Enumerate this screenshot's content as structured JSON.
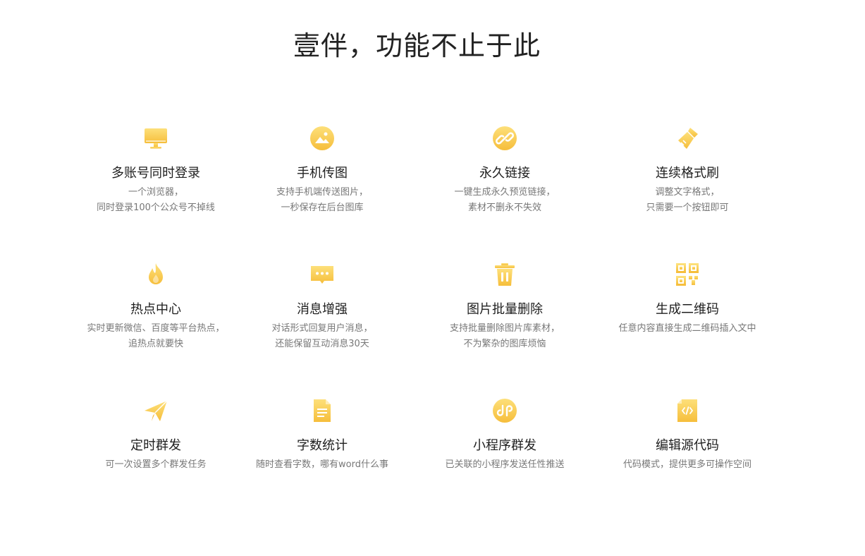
{
  "page": {
    "title": "壹伴，功能不止于此"
  },
  "colors": {
    "accent_top": "#FDE07A",
    "accent_bottom": "#F6BE3B"
  },
  "features": [
    {
      "icon": "monitor-icon",
      "title": "多账号同时登录",
      "desc": [
        "一个浏览器，",
        "同时登录100个公众号不掉线"
      ]
    },
    {
      "icon": "image-icon",
      "title": "手机传图",
      "desc": [
        "支持手机端传送图片，",
        "一秒保存在后台图库"
      ]
    },
    {
      "icon": "link-icon",
      "title": "永久链接",
      "desc": [
        "一键生成永久预览链接，",
        "素材不删永不失效"
      ]
    },
    {
      "icon": "brush-icon",
      "title": "连续格式刷",
      "desc": [
        "调整文字格式，",
        "只需要一个按钮即可"
      ]
    },
    {
      "icon": "fire-icon",
      "title": "热点中心",
      "desc": [
        "实时更新微信、百度等平台热点，",
        "追热点就要快"
      ]
    },
    {
      "icon": "message-icon",
      "title": "消息增强",
      "desc": [
        "对话形式回复用户消息，",
        "还能保留互动消息30天"
      ]
    },
    {
      "icon": "trash-icon",
      "title": "图片批量删除",
      "desc": [
        "支持批量删除图片库素材，",
        "不为繁杂的图库烦恼"
      ]
    },
    {
      "icon": "qrcode-icon",
      "title": "生成二维码",
      "desc": [
        "任意内容直接生成二维码插入文中"
      ]
    },
    {
      "icon": "send-icon",
      "title": "定时群发",
      "desc": [
        "可一次设置多个群发任务"
      ]
    },
    {
      "icon": "document-icon",
      "title": "字数统计",
      "desc": [
        "随时查看字数，哪有word什么事"
      ]
    },
    {
      "icon": "miniprogram-icon",
      "title": "小程序群发",
      "desc": [
        "已关联的小程序发送任性推送"
      ]
    },
    {
      "icon": "code-icon",
      "title": "编辑源代码",
      "desc": [
        "代码模式，提供更多可操作空间"
      ]
    }
  ]
}
